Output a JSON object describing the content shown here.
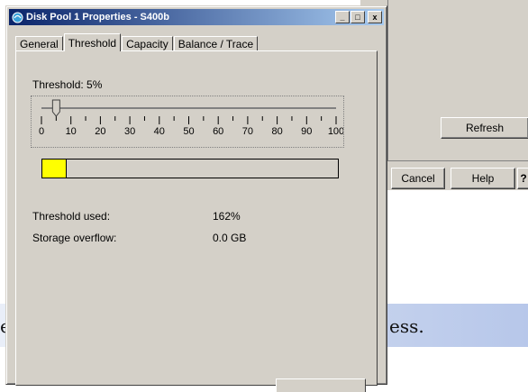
{
  "background_window": {
    "refresh_label": "Refresh",
    "cancel_label": "Cancel",
    "help_label": "Help",
    "question_label": "?"
  },
  "background_doc": {
    "left_fragment": "e",
    "right_fragment": "ess."
  },
  "dialog": {
    "title": "Disk Pool 1 Properties - S400b",
    "controls": {
      "minimize": "_",
      "maximize": "□",
      "close": "x"
    },
    "tabs": [
      {
        "label": "General",
        "active": false
      },
      {
        "label": "Threshold",
        "active": true
      },
      {
        "label": "Capacity",
        "active": false
      },
      {
        "label": "Balance / Trace",
        "active": false
      }
    ]
  },
  "threshold": {
    "label": "Threshold:  5%",
    "slider_value": 5,
    "slider_min": 0,
    "slider_max": 100,
    "tick_labels": [
      "0",
      "10",
      "20",
      "30",
      "40",
      "50",
      "60",
      "70",
      "80",
      "90",
      "100"
    ],
    "usage_fill_fraction": 0.08,
    "usage_fill_color": "#ffff00"
  },
  "stats": {
    "threshold_used_label": "Threshold used:",
    "threshold_used_value": "162%",
    "storage_overflow_label": "Storage overflow:",
    "storage_overflow_value": "0.0 GB"
  }
}
